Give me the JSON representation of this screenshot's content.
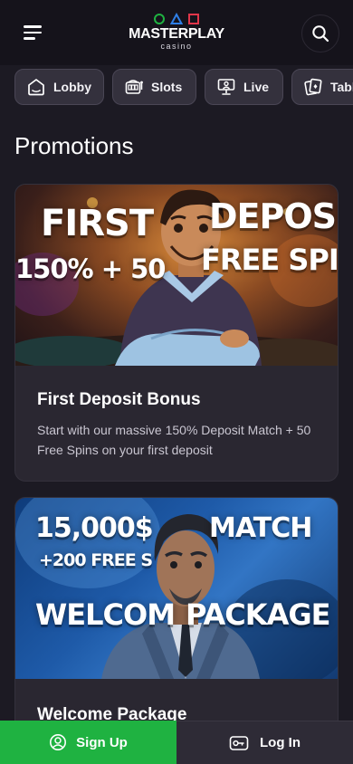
{
  "header": {
    "logo_title": "MASTERPLAY",
    "logo_subtitle": "casino"
  },
  "tabs": [
    {
      "label": "Lobby",
      "icon": "lobby-icon"
    },
    {
      "label": "Slots",
      "icon": "slot-machine-icon"
    },
    {
      "label": "Live",
      "icon": "live-dealer-icon"
    },
    {
      "label": "Tabl",
      "icon": "table-games-icon"
    }
  ],
  "page_title": "Promotions",
  "promotions": [
    {
      "banner_line1_a": "FIRST",
      "banner_line1_b": "DEPOSIT",
      "banner_line2_a": "150% + 50",
      "banner_line2_b": "FREE SPINS",
      "title": "First Deposit Bonus",
      "description": "Start with our massive 150% Deposit Match + 50 Free Spins on your first deposit"
    },
    {
      "banner_line1_a": "15,000$",
      "banner_line1_b": "MATCH",
      "banner_line2_a": "+200 FREE S",
      "banner_line3_a": "WELCOM",
      "banner_line3_b": "PACKAGE",
      "title": "Welcome Package"
    }
  ],
  "bottom_bar": {
    "signup_label": "Sign Up",
    "login_label": "Log In"
  },
  "colors": {
    "background": "#1c1a23",
    "header": "#15131b",
    "tab": "#34313d",
    "card": "#2a2731",
    "signup_green": "#1fb241",
    "login_bg": "#2e2b36"
  }
}
